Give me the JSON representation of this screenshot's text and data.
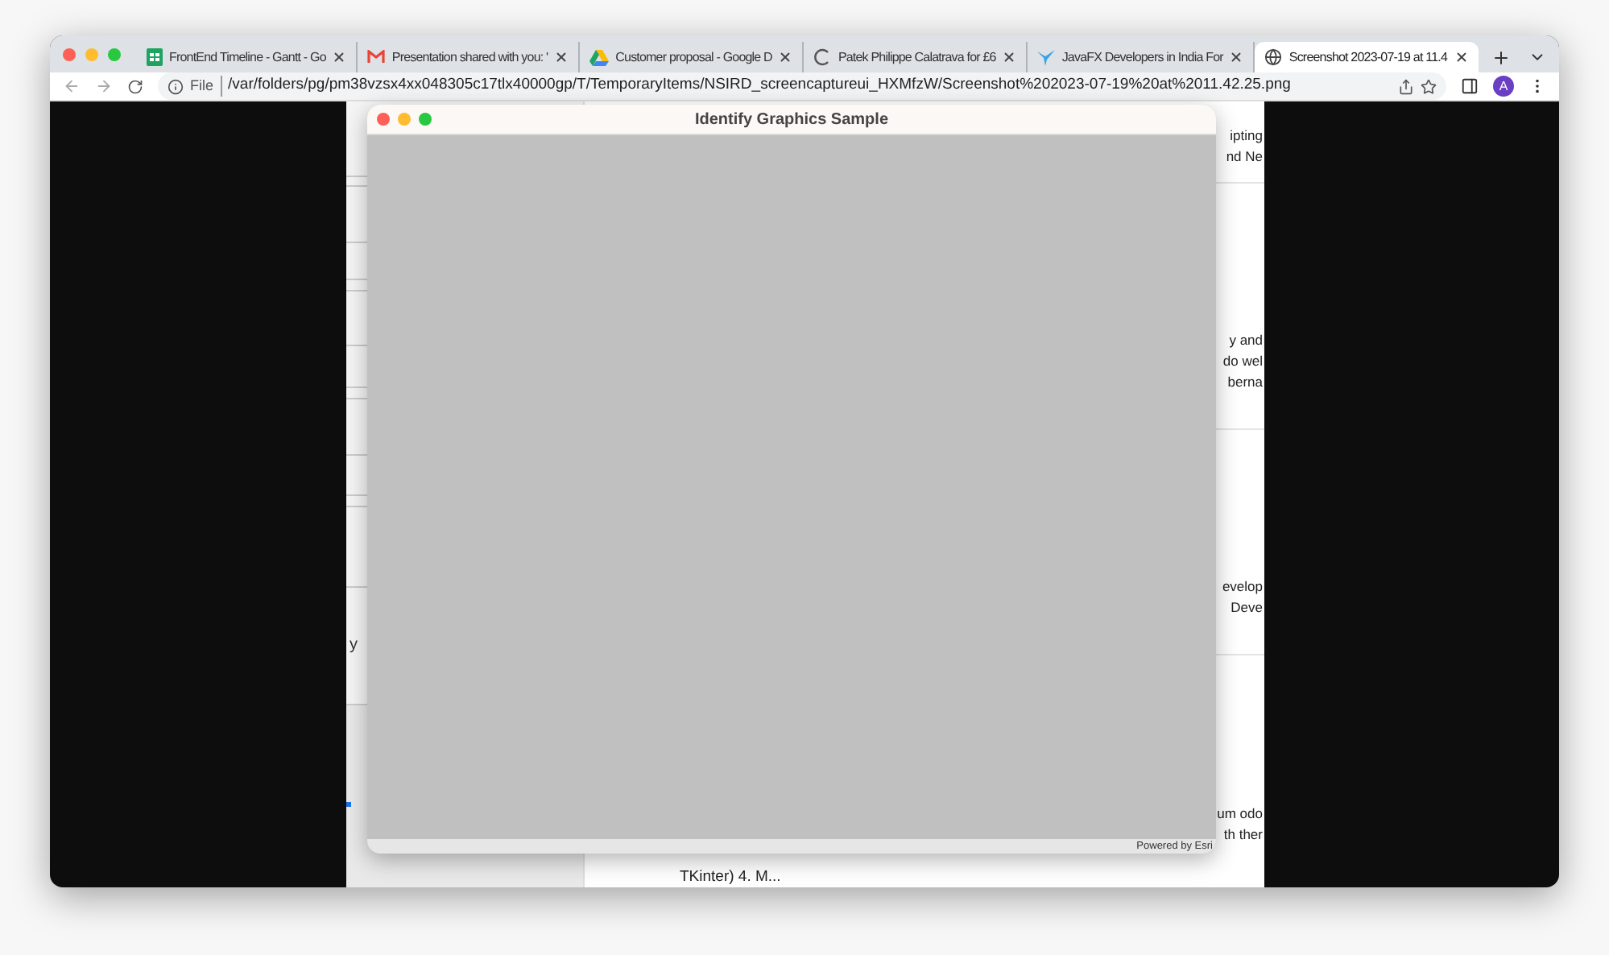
{
  "browser": {
    "tabs": [
      {
        "title": "FrontEnd Timeline - Gantt - Go",
        "selected": false
      },
      {
        "title": "Presentation shared with you: '",
        "selected": false
      },
      {
        "title": "Customer proposal - Google D",
        "selected": false
      },
      {
        "title": "Patek Philippe Calatrava for £6",
        "selected": false
      },
      {
        "title": "JavaFX Developers in India For",
        "selected": false
      },
      {
        "title": "Screenshot 2023-07-19 at 11.4",
        "selected": true
      }
    ],
    "address_bar": {
      "scheme": "File",
      "url": "/var/folders/pg/pm38vzsx4xx048305c17tlx40000gp/T/TemporaryItems/NSIRD_screencaptureui_HXMfzW/Screenshot%202023-07-19%20at%2011.42.25.png"
    },
    "profile": "A"
  },
  "page": {
    "sidebar": {
      "fragment": "y"
    },
    "sections": [
      {
        "lines": [
          "ipting",
          "nd Ne"
        ]
      },
      {
        "lines": [
          "y and",
          "do wel",
          "berna"
        ]
      },
      {
        "lines": [
          "evelop",
          "Deve"
        ]
      },
      {
        "lines": [
          "um odo",
          "th ther"
        ],
        "footer": "TKinter) 4. M..."
      }
    ]
  },
  "app_window": {
    "title": "Identify Graphics Sample",
    "attribution": "Powered by Esri"
  }
}
